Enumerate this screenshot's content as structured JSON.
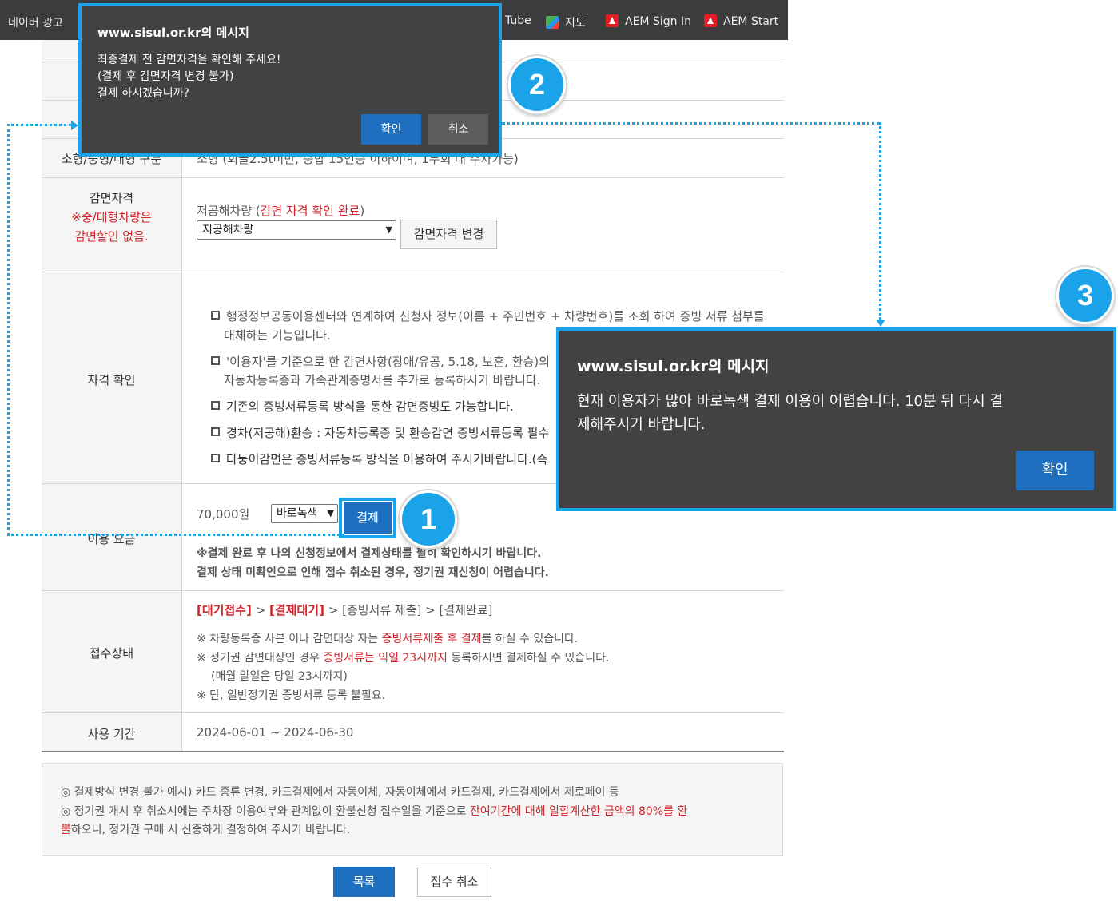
{
  "bookmarks": [
    {
      "label": "네이버 광고"
    },
    {
      "label": "Tube"
    },
    {
      "label": "지도",
      "icon": "map-icon"
    },
    {
      "label": "AEM Sign In",
      "icon": "adobe-icon"
    },
    {
      "label": "AEM Start",
      "icon": "adobe-icon"
    }
  ],
  "table": {
    "size_label": "소형/중형/대형 구분",
    "size_value": "소형 (회글2.5t미만, 승합 15인승 이하이며, 1두회 대 주차가능)",
    "discount": {
      "label": "감면자격",
      "note_line1": "※중/대형차량은",
      "note_line2": "감면할인 없음.",
      "status_prefix": "저공해차량 (",
      "status_highlight": "감면 자격 확인 완료",
      "status_suffix": ")",
      "select_value": "저공해차량",
      "change_button": "감면자격 변경"
    },
    "qualification": {
      "label": "자격 확인",
      "items": [
        {
          "text": "행정정보공동이용센터와 연계하여 신청자 정보(이름 + 주민번호 + 차량번호)를 조회 하여 증빙 서류 첨부를",
          "cont": "대체하는 기능입니다."
        },
        {
          "text": "'이용자'를 기준으로 한 감면사항(장애/유공, 5.18, 보훈, 환승)의",
          "cont": "자동차등록증과 가족관계증명서를 추가로 등록하시기 바랍니다."
        },
        {
          "text": "기존의 증빙서류등록 방식을 통한 감면증빙도 가능합니다."
        },
        {
          "text": "경차(저공해)환승 : 자동차등록증 및 환승감면 증빙서류등록 필수"
        },
        {
          "text": "다둥이감면은 증빙서류등록 방식을 이용하여 주시기바랍니다.(즉"
        }
      ]
    },
    "fee": {
      "label": "이용 요금",
      "amount": "70,000원",
      "method": "바로녹색",
      "pay_button": "결제",
      "warning1": "※결제 완료 후 나의 신청정보에서 결제상태를 필히 확인하시기 바랍니다.",
      "warning2": "결제 상태 미확인으로 인해 접수 취소된 경우, 정기권 재신청이 어렵습니다."
    },
    "status": {
      "label": "접수상태",
      "steps": [
        "[대기접수]",
        "[결제대기]",
        "[증빙서류 제출]",
        "[결제완료]"
      ],
      "sep": " > ",
      "note1_a": "※ 차량등록증 사본 이나 감면대상 자는 ",
      "note1_b": "증빙서류제출 후 결제",
      "note1_c": "를 하실 수 있습니다.",
      "note2_a": "※ 정기권 감면대상인 경우 ",
      "note2_b": "증빙서류는 익일 23시까지",
      "note2_c": " 등록하시면 결제하실 수 있습니다.",
      "note3": "(매월 말일은 당일 23시까지)",
      "note4": "※ 단, 일반정기권 증빙서류 등록 불필요."
    },
    "period": {
      "label": "사용 기간",
      "value": "2024-06-01 ~ 2024-06-30"
    }
  },
  "notice": {
    "line1": "◎ 결제방식 변경 불가 예시) 카드 종류 변경, 카드결제에서 자동이체, 자동이체에서 카드결제, 카드결제에서 제로페이 등",
    "line2_a": "◎ 정기권 개시 후 취소시에는 주차장 이용여부와 관계없이 환불신청 접수일을 기준으로 ",
    "line2_b": "잔여기간에 대해 일할계산한 금액의 80%를 환",
    "line3_a": "불",
    "line3_b": "하오니, 정기권 구매 시 신중하게 결정하여 주시기 바랍니다."
  },
  "footer": {
    "list_button": "목록",
    "cancel_button": "접수 취소"
  },
  "dialog1": {
    "title": "www.sisul.or.kr의 메시지",
    "line1": "최종결제 전 감면자격을 확인해 주세요!",
    "line2": "(결제 후 감면자격 변경 불가)",
    "line3": "결제 하시겠습니까?",
    "ok": "확인",
    "cancel": "취소"
  },
  "dialog2": {
    "title": "www.sisul.or.kr의 메시지",
    "line1": "현재 이용자가 많아 바로녹색 결제 이용이 어렵습니다. 10분 뒤 다시 결",
    "line2": "제해주시기 바랍니다.",
    "ok": "확인"
  },
  "steps": {
    "one": "1",
    "two": "2",
    "three": "3"
  },
  "colors": {
    "accent": "#1aa3e8",
    "button_blue": "#1e6fc0",
    "dialog_bg": "#424242",
    "red": "#d2232a"
  }
}
